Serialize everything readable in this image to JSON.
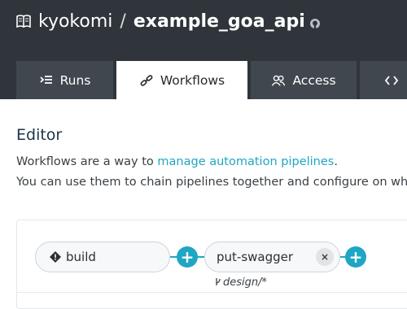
{
  "header": {
    "owner": "kyokomi",
    "separator": "/",
    "repo": "example_goa_api",
    "icons": {
      "repo": "book-icon",
      "github": "github-icon"
    },
    "background_color": "#2f353b"
  },
  "tabs": [
    {
      "label": "Runs",
      "icon": "runs-list-icon",
      "active": false
    },
    {
      "label": "Workflows",
      "icon": "workflows-icon",
      "active": true
    },
    {
      "label": "Access",
      "icon": "access-users-icon",
      "active": false
    },
    {
      "label": "",
      "icon": "code-icon",
      "active": false
    }
  ],
  "editor": {
    "title": "Editor",
    "desc_line1_prefix": "Workflows are a way to ",
    "desc_line1_link": "manage automation pipelines",
    "desc_line1_suffix": ".",
    "desc_line2": "You can use them to chain pipelines together and configure on whi"
  },
  "workflow": {
    "pipelines": [
      {
        "name": "build",
        "icon": "diamond-icon"
      },
      {
        "name": "put-swagger",
        "remove_label": "×",
        "branch": "design/*",
        "branch_icon": "branch-icon"
      }
    ],
    "add_label": "+"
  },
  "colors": {
    "accent": "#1fa6c4",
    "tab_inactive": "#40474e",
    "text": "#3a4045"
  }
}
